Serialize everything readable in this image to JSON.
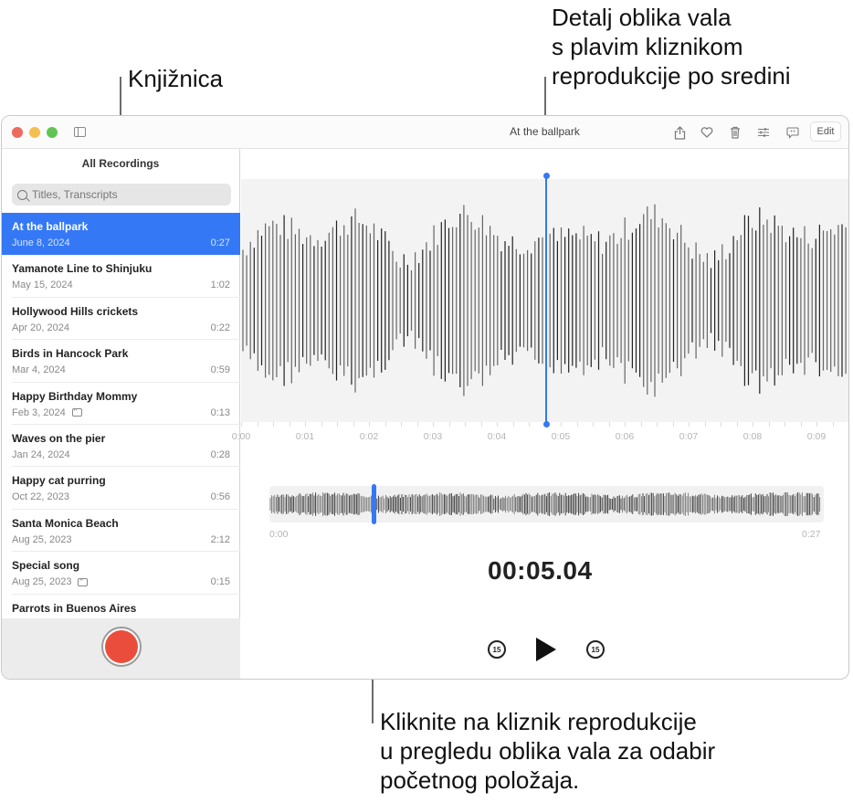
{
  "callouts": {
    "library": "Knjižnica",
    "detail": "Detalj oblika vala\ns plavim kliznikom\nreprodukcije po sredini",
    "overview": "Kliknite na kliznik reprodukcije\nu pregledu oblika vala za odabir\npočetnog položaja."
  },
  "window": {
    "title": "At the ballpark",
    "traffic_lights": [
      "#ed6a5e",
      "#f5bf4f",
      "#61c554"
    ],
    "toolbar": {
      "icons": [
        "share-icon",
        "heart-icon",
        "trash-icon",
        "sliders-icon",
        "transcript-icon"
      ],
      "edit_label": "Edit"
    }
  },
  "sidebar": {
    "title": "All Recordings",
    "search_placeholder": "Titles, Transcripts",
    "recordings": [
      {
        "title": "At the ballpark",
        "date": "June 8, 2024",
        "duration": "0:27",
        "selected": true,
        "transcript": false
      },
      {
        "title": "Yamanote Line to Shinjuku",
        "date": "May 15, 2024",
        "duration": "1:02",
        "selected": false,
        "transcript": false
      },
      {
        "title": "Hollywood Hills crickets",
        "date": "Apr 20, 2024",
        "duration": "0:22",
        "selected": false,
        "transcript": false
      },
      {
        "title": "Birds in Hancock Park",
        "date": "Mar 4, 2024",
        "duration": "0:59",
        "selected": false,
        "transcript": false
      },
      {
        "title": "Happy Birthday Mommy",
        "date": "Feb 3, 2024",
        "duration": "0:13",
        "selected": false,
        "transcript": true
      },
      {
        "title": "Waves on the pier",
        "date": "Jan 24, 2024",
        "duration": "0:28",
        "selected": false,
        "transcript": false
      },
      {
        "title": "Happy cat purring",
        "date": "Oct 22, 2023",
        "duration": "0:56",
        "selected": false,
        "transcript": false
      },
      {
        "title": "Santa Monica Beach",
        "date": "Aug 25, 2023",
        "duration": "2:12",
        "selected": false,
        "transcript": false
      },
      {
        "title": "Special song",
        "date": "Aug 25, 2023",
        "duration": "0:15",
        "selected": false,
        "transcript": true
      },
      {
        "title": "Parrots in Buenos Aires",
        "date": "",
        "duration": "",
        "selected": false,
        "transcript": false
      }
    ]
  },
  "player": {
    "ruler_labels": [
      "0:00",
      "0:01",
      "0:02",
      "0:03",
      "0:04",
      "0:05",
      "0:06",
      "0:07",
      "0:08",
      "0:09"
    ],
    "overview_start": "0:00",
    "overview_end": "0:27",
    "current_time": "00:05.04",
    "playhead_fraction": 0.187,
    "skip_back_label": "15",
    "skip_forward_label": "15",
    "accent_color": "#3478f6"
  }
}
